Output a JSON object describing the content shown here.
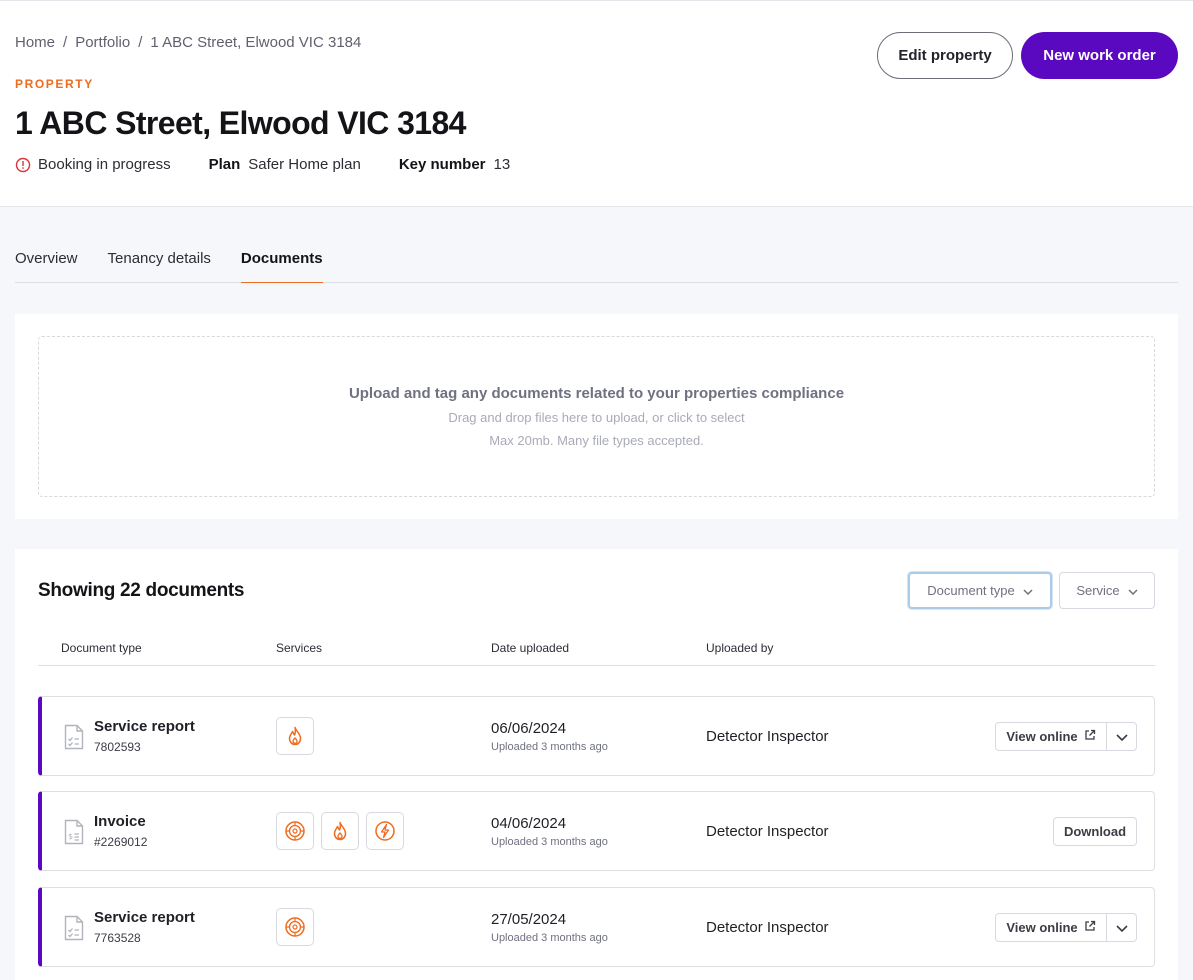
{
  "breadcrumb": {
    "items": [
      "Home",
      "Portfolio",
      "1 ABC Street, Elwood VIC 3184"
    ],
    "separator": "/"
  },
  "header": {
    "eyebrow": "PROPERTY",
    "title": "1 ABC Street, Elwood VIC 3184",
    "status": "Booking in progress",
    "plan_label": "Plan",
    "plan_value": "Safer Home plan",
    "key_label": "Key number",
    "key_value": "13",
    "edit_button": "Edit property",
    "new_button": "New work order"
  },
  "tabs": [
    {
      "label": "Overview",
      "active": false
    },
    {
      "label": "Tenancy details",
      "active": false
    },
    {
      "label": "Documents",
      "active": true
    }
  ],
  "upload": {
    "title": "Upload and tag any documents related to your properties compliance",
    "subtitle": "Drag and drop files here to upload, or click to select",
    "limits": "Max 20mb. Many file types accepted."
  },
  "documents": {
    "count_label": "Showing 22 documents",
    "filters": {
      "document_type": "Document type",
      "service": "Service"
    },
    "columns": [
      "Document type",
      "Services",
      "Date uploaded",
      "Uploaded by"
    ],
    "rows": [
      {
        "name": "Service report",
        "number": "7802593",
        "services": [
          "fire-icon"
        ],
        "date": "06/06/2024",
        "ago": "Uploaded 3 months ago",
        "by": "Detector Inspector",
        "action": "View online"
      },
      {
        "name": "Invoice",
        "number": "#2269012",
        "services": [
          "smoke-alarm-icon",
          "fire-icon",
          "electrical-icon"
        ],
        "date": "04/06/2024",
        "ago": "Uploaded 3 months ago",
        "by": "Detector Inspector",
        "action": "Download"
      },
      {
        "name": "Service report",
        "number": "7763528",
        "services": [
          "smoke-alarm-icon"
        ],
        "date": "27/05/2024",
        "ago": "Uploaded 3 months ago",
        "by": "Detector Inspector",
        "action": "View online"
      }
    ]
  },
  "colors": {
    "accent": "#5a09c1",
    "orange": "#ee6b1f",
    "alert": "#d9343a"
  }
}
